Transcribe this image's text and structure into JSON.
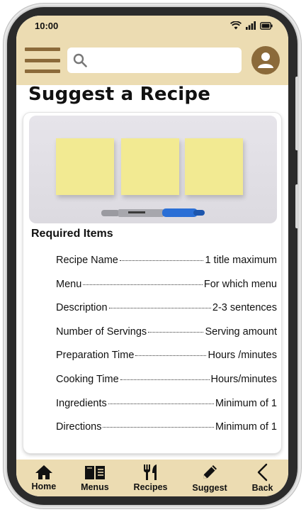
{
  "status_bar": {
    "time": "10:00"
  },
  "app_bar": {
    "search_placeholder": ""
  },
  "page_title": "Suggest a Recipe",
  "card": {
    "required_heading": "Required Items",
    "items": [
      {
        "label": "Recipe Name",
        "value": "1 title maximum"
      },
      {
        "label": "Menu",
        "value": "For which menu"
      },
      {
        "label": "Description",
        "value": "2-3 sentences"
      },
      {
        "label": "Number of Servings",
        "value": "Serving amount"
      },
      {
        "label": "Preparation Time",
        "value": "Hours /minutes"
      },
      {
        "label": "Cooking Time",
        "value": "Hours/minutes"
      },
      {
        "label": "Ingredients",
        "value": "Minimum of 1"
      },
      {
        "label": "Directions",
        "value": "Minimum of 1"
      }
    ]
  },
  "bottom_nav": [
    {
      "label": "Home",
      "icon": "home-icon"
    },
    {
      "label": "Menus",
      "icon": "menu-book-icon"
    },
    {
      "label": "Recipes",
      "icon": "fork-knife-icon"
    },
    {
      "label": "Suggest",
      "icon": "pencil-icon"
    },
    {
      "label": "Back",
      "icon": "chevron-left-icon"
    }
  ],
  "colors": {
    "accent_bg": "#ecdcb2",
    "brand_brown": "#8b6a3a",
    "note_yellow": "#f2ea92",
    "marker_blue": "#2a6fd6"
  }
}
